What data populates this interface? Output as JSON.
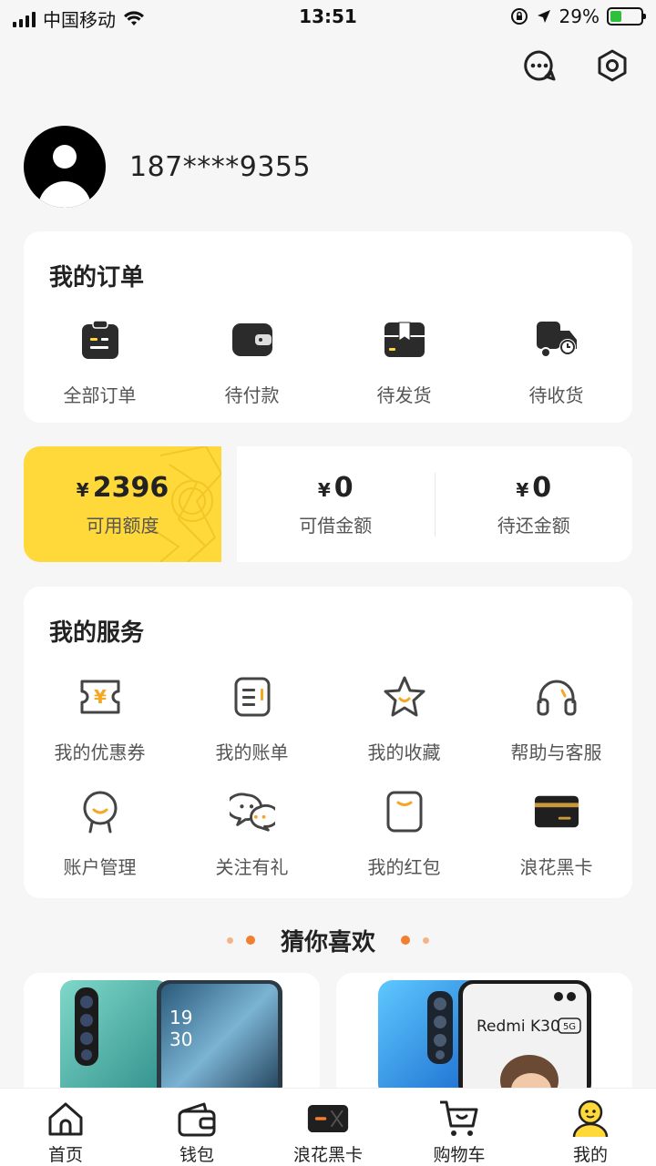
{
  "status_bar": {
    "carrier": "中国移动",
    "time": "13:51",
    "battery_percent": "29%"
  },
  "profile": {
    "phone": "187****9355"
  },
  "orders": {
    "title": "我的订单",
    "items": [
      {
        "label": "全部订单",
        "icon": "clipboard-icon"
      },
      {
        "label": "待付款",
        "icon": "wallet-icon"
      },
      {
        "label": "待发货",
        "icon": "package-icon"
      },
      {
        "label": "待收货",
        "icon": "truck-icon"
      }
    ]
  },
  "credit": {
    "currency": "¥",
    "available": {
      "value": "2396",
      "label": "可用额度"
    },
    "borrowable": {
      "value": "0",
      "label": "可借金额"
    },
    "repay": {
      "value": "0",
      "label": "待还金额"
    }
  },
  "services": {
    "title": "我的服务",
    "items": [
      {
        "label": "我的优惠券",
        "icon": "coupon-icon"
      },
      {
        "label": "我的账单",
        "icon": "bill-icon"
      },
      {
        "label": "我的收藏",
        "icon": "star-icon"
      },
      {
        "label": "帮助与客服",
        "icon": "headset-icon"
      },
      {
        "label": "账户管理",
        "icon": "account-icon"
      },
      {
        "label": "关注有礼",
        "icon": "wechat-icon"
      },
      {
        "label": "我的红包",
        "icon": "red-packet-icon"
      },
      {
        "label": "浪花黑卡",
        "icon": "black-card-icon"
      }
    ]
  },
  "guess": {
    "title": "猜你喜欢"
  },
  "products": [
    {
      "name": "phone-product-1"
    },
    {
      "name": "phone-product-2",
      "brand_text": "Redmi K30",
      "badge": "5G"
    }
  ],
  "tabbar": {
    "items": [
      {
        "label": "首页",
        "icon": "home-icon"
      },
      {
        "label": "钱包",
        "icon": "wallet-icon"
      },
      {
        "label": "浪花黑卡",
        "icon": "black-card-icon"
      },
      {
        "label": "购物车",
        "icon": "cart-icon"
      },
      {
        "label": "我的",
        "icon": "user-icon"
      }
    ]
  },
  "colors": {
    "accent": "#FFD83A",
    "orange": "#F07F31",
    "background": "#F6F6F6"
  }
}
